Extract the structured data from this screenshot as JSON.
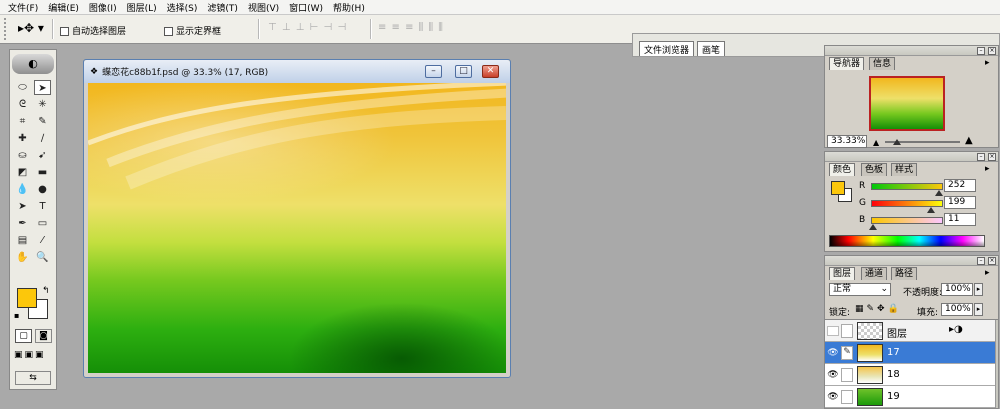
{
  "menu": [
    "文件(F)",
    "编辑(E)",
    "图像(I)",
    "图层(L)",
    "选择(S)",
    "滤镜(T)",
    "视图(V)",
    "窗口(W)",
    "帮助(H)"
  ],
  "options": {
    "auto_select_label": "自动选择图层",
    "show_bounds_label": "显示定界框"
  },
  "well_tabs": [
    "文件浏览器",
    "画笔"
  ],
  "document": {
    "title": "蝶恋花c88b1f.psd @ 33.3% (17, RGB)"
  },
  "navigator": {
    "tabs": [
      "导航器",
      "信息"
    ],
    "zoom": "33.33%"
  },
  "color_panel": {
    "tabs": [
      "颜色",
      "色板",
      "样式"
    ],
    "channels": [
      {
        "label": "R",
        "value": "252"
      },
      {
        "label": "G",
        "value": "199"
      },
      {
        "label": "B",
        "value": "11"
      }
    ],
    "foreground": "#fcc70b"
  },
  "layers_panel": {
    "tabs": [
      "图层",
      "通道",
      "路径"
    ],
    "blend_mode": "正常",
    "opacity_label": "不透明度:",
    "opacity": "100%",
    "lock_label": "锁定:",
    "fill_label": "填充:",
    "fill": "100%",
    "layers": [
      {
        "name": "图层"
      },
      {
        "name": "17"
      },
      {
        "name": "18"
      },
      {
        "name": "19"
      }
    ]
  }
}
